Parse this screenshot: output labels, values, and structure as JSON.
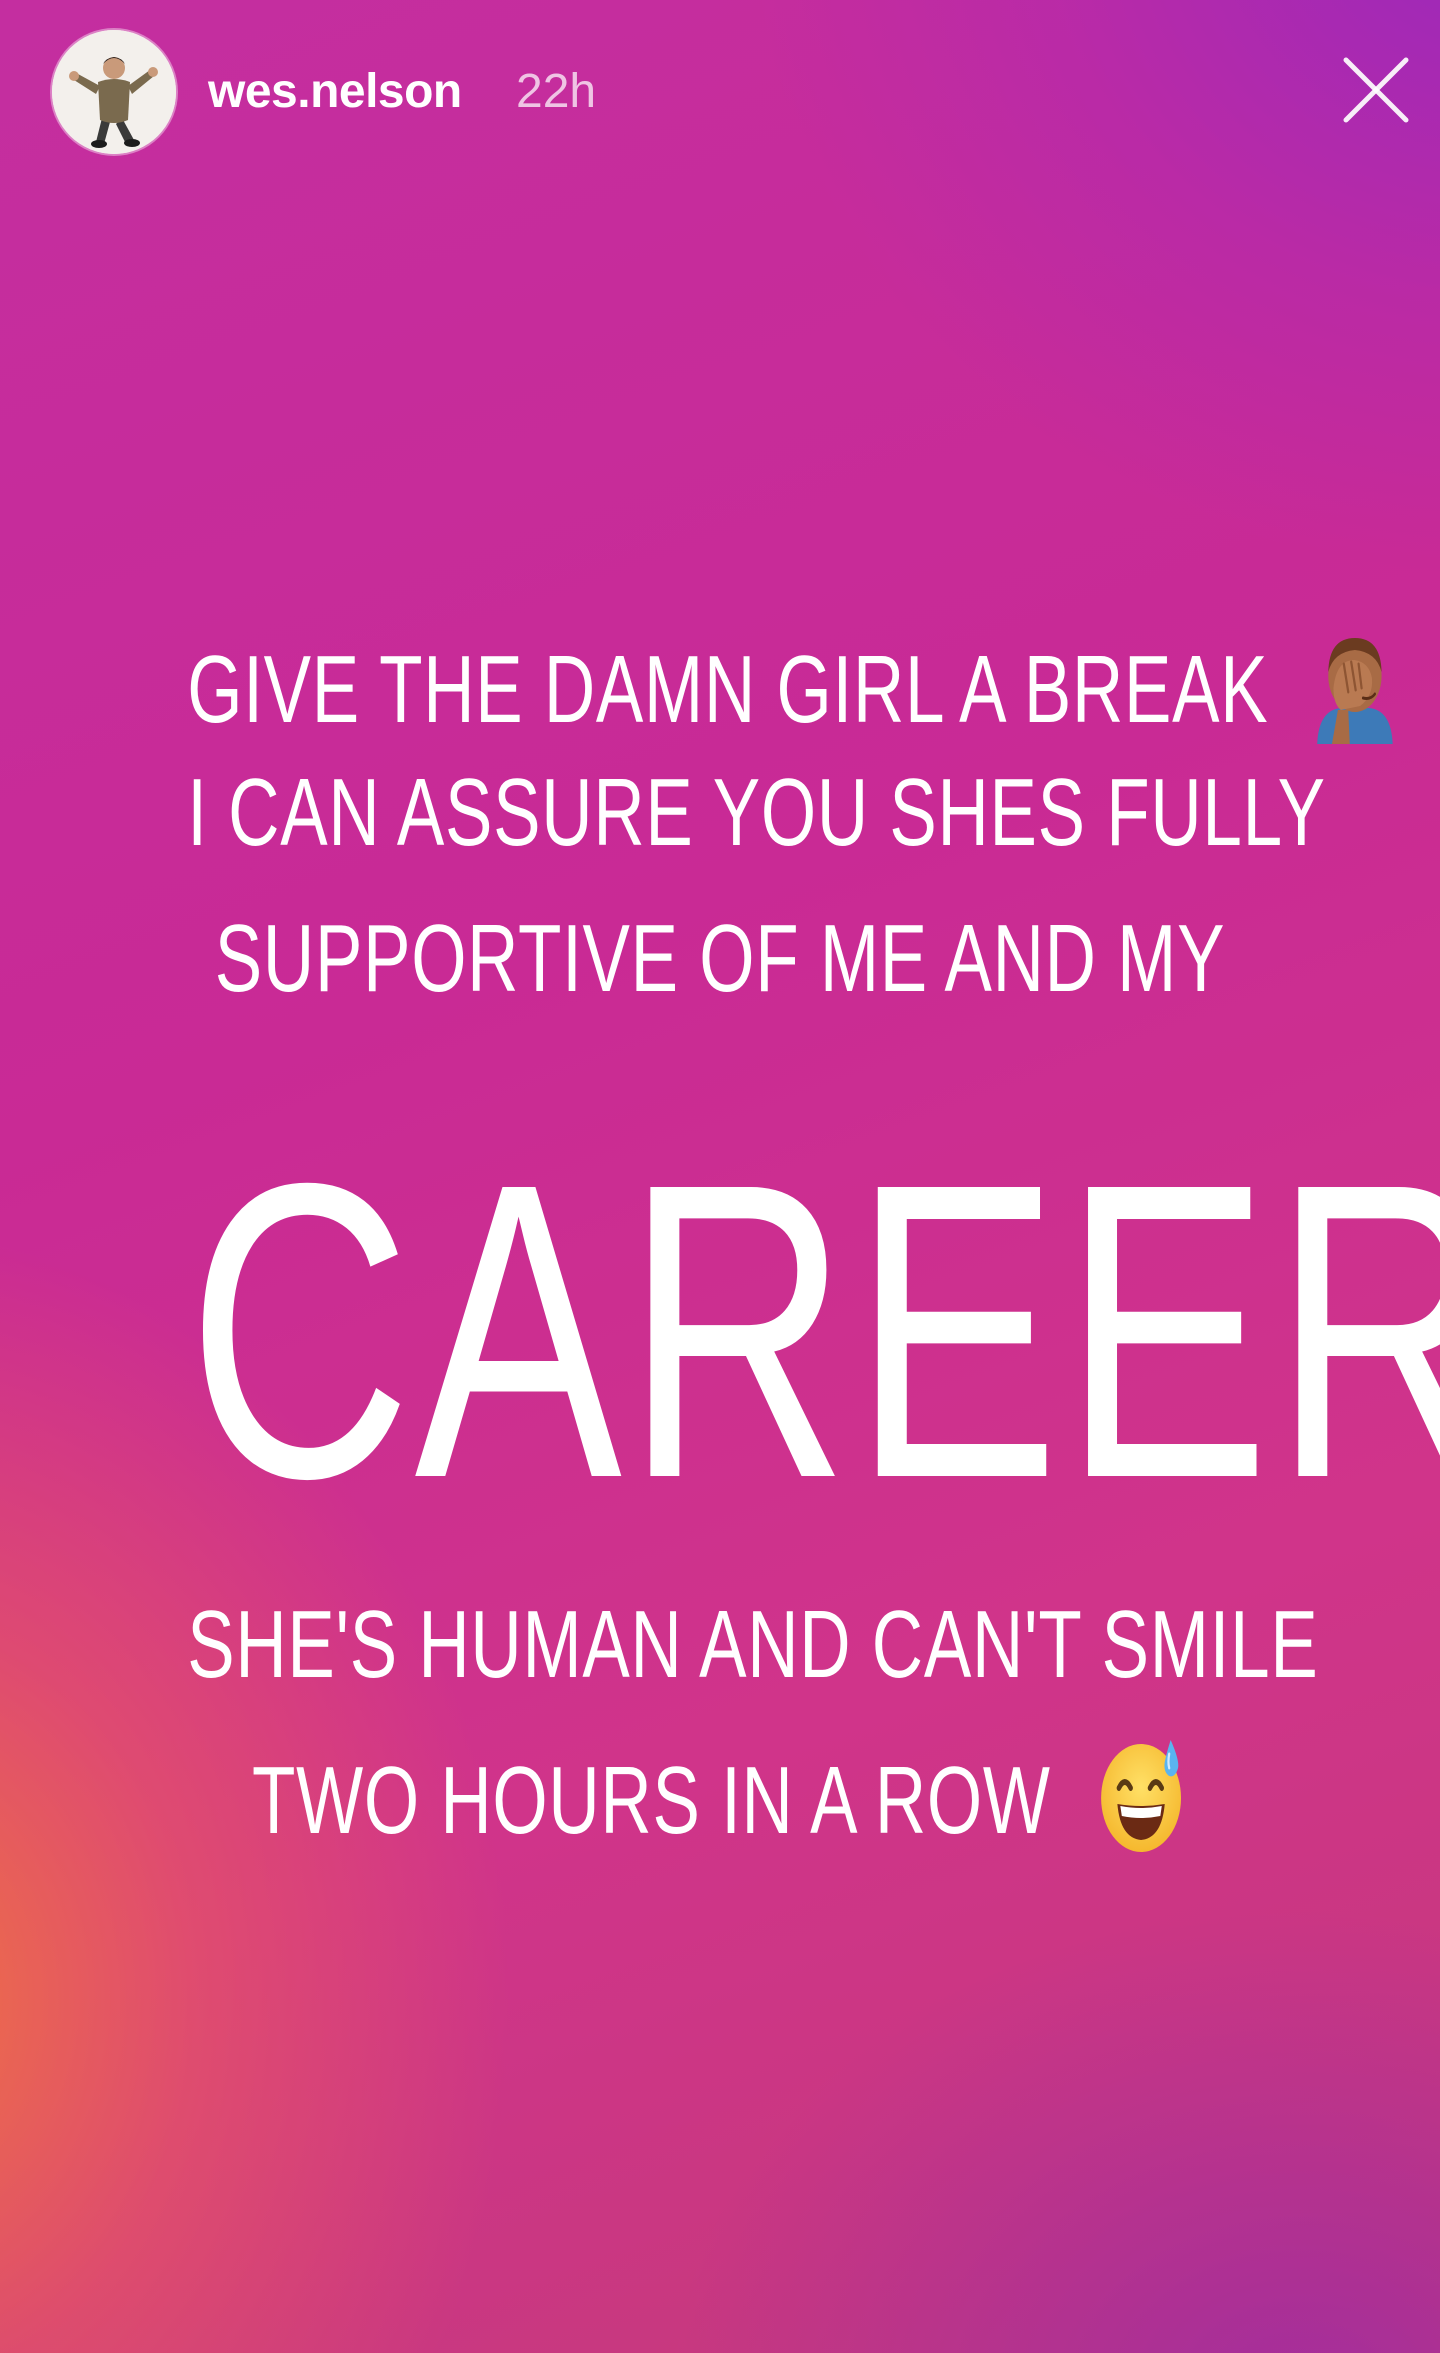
{
  "header": {
    "username": "wes.nelson",
    "time": "22h",
    "avatar_icon": "user-avatar-icon",
    "close_icon": "close-icon"
  },
  "story": {
    "lines": [
      "GIVE THE DAMN GIRL A BREAK",
      "I CAN ASSURE YOU SHES FULLY",
      "SUPPORTIVE OF ME AND MY",
      "CAREER",
      "SHE'S HUMAN AND CAN'T SMILE",
      "TWO HOURS IN A ROW"
    ],
    "emoji_1": "face-palm-emoji",
    "emoji_2": "grinning-sweat-emoji"
  },
  "colors": {
    "text": "#ffffff",
    "gradient_orange": "#f2783c",
    "gradient_magenta": "#c42ea0",
    "gradient_purple": "#9628be"
  }
}
